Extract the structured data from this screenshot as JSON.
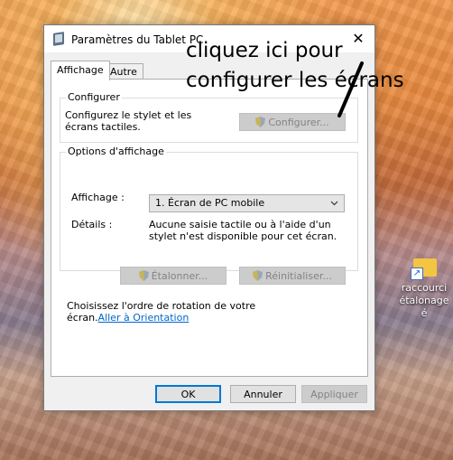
{
  "window": {
    "title": "Paramètres du Tablet PC",
    "close_symbol": "✕",
    "icon": "tablet-settings-icon"
  },
  "tabs": [
    {
      "label": "Affichage",
      "active": true
    },
    {
      "label": "Autre",
      "active": false
    }
  ],
  "configure_group": {
    "legend": "Configurer",
    "description": "Configurez le stylet et les écrans tactiles.",
    "button": "Configurer..."
  },
  "display_group": {
    "legend": "Options d'affichage",
    "display_label": "Affichage :",
    "display_value": "1. Écran de PC mobile",
    "details_label": "Détails :",
    "details_text": "Aucune saisie tactile ou à l'aide d'un stylet n'est disponible pour cet écran.",
    "calibrate_button": "Étalonner...",
    "reset_button": "Réinitialiser..."
  },
  "orientation": {
    "text": "Choisissez l'ordre de rotation de votre écran.",
    "link": "Aller à Orientation"
  },
  "footer": {
    "ok": "OK",
    "cancel": "Annuler",
    "apply": "Appliquer"
  },
  "annotation": {
    "text": "cliquez ici pour configurer les écrans"
  },
  "desktop_icon": {
    "label": "raccourci\nétalonage é",
    "icon": "folder-shortcut-icon"
  },
  "colors": {
    "accent": "#0078d7",
    "link": "#0066cc"
  }
}
